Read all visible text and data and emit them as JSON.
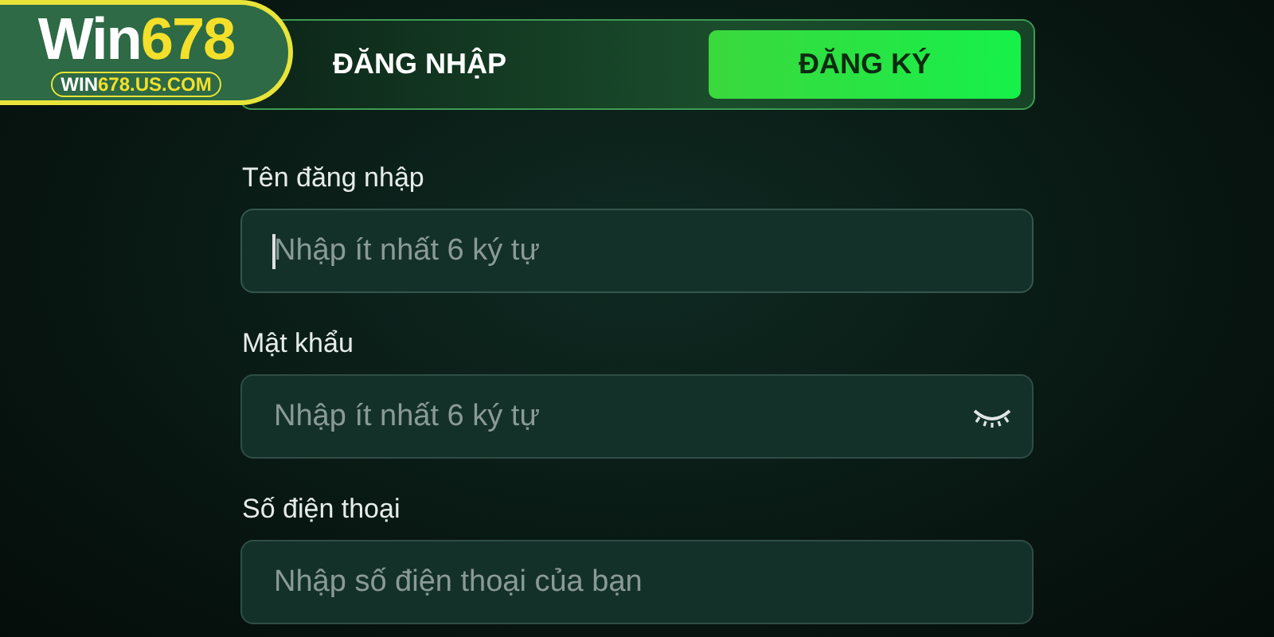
{
  "logo": {
    "parts": [
      {
        "text": "Win",
        "accent": false
      },
      {
        "text": "678",
        "accent": true
      }
    ],
    "domain_parts": [
      {
        "text": "WIN",
        "accent": false
      },
      {
        "text": "678.US.COM",
        "accent": true
      }
    ]
  },
  "tabs": [
    {
      "label": "ĐĂNG NHẬP",
      "selected": false
    },
    {
      "label": "ĐĂNG KÝ",
      "selected": true
    }
  ],
  "fields": [
    {
      "kind": "text",
      "label": "Tên đăng nhập",
      "placeholder": "Nhập ít nhất 6 ký tự",
      "focused": true
    },
    {
      "kind": "password",
      "label": "Mật khẩu",
      "placeholder": "Nhập ít nhất 6 ký tự",
      "focused": false
    },
    {
      "kind": "phone",
      "label": "Số điện thoại",
      "placeholder": "Nhập số điện thoại của bạn",
      "focused": false
    }
  ]
}
